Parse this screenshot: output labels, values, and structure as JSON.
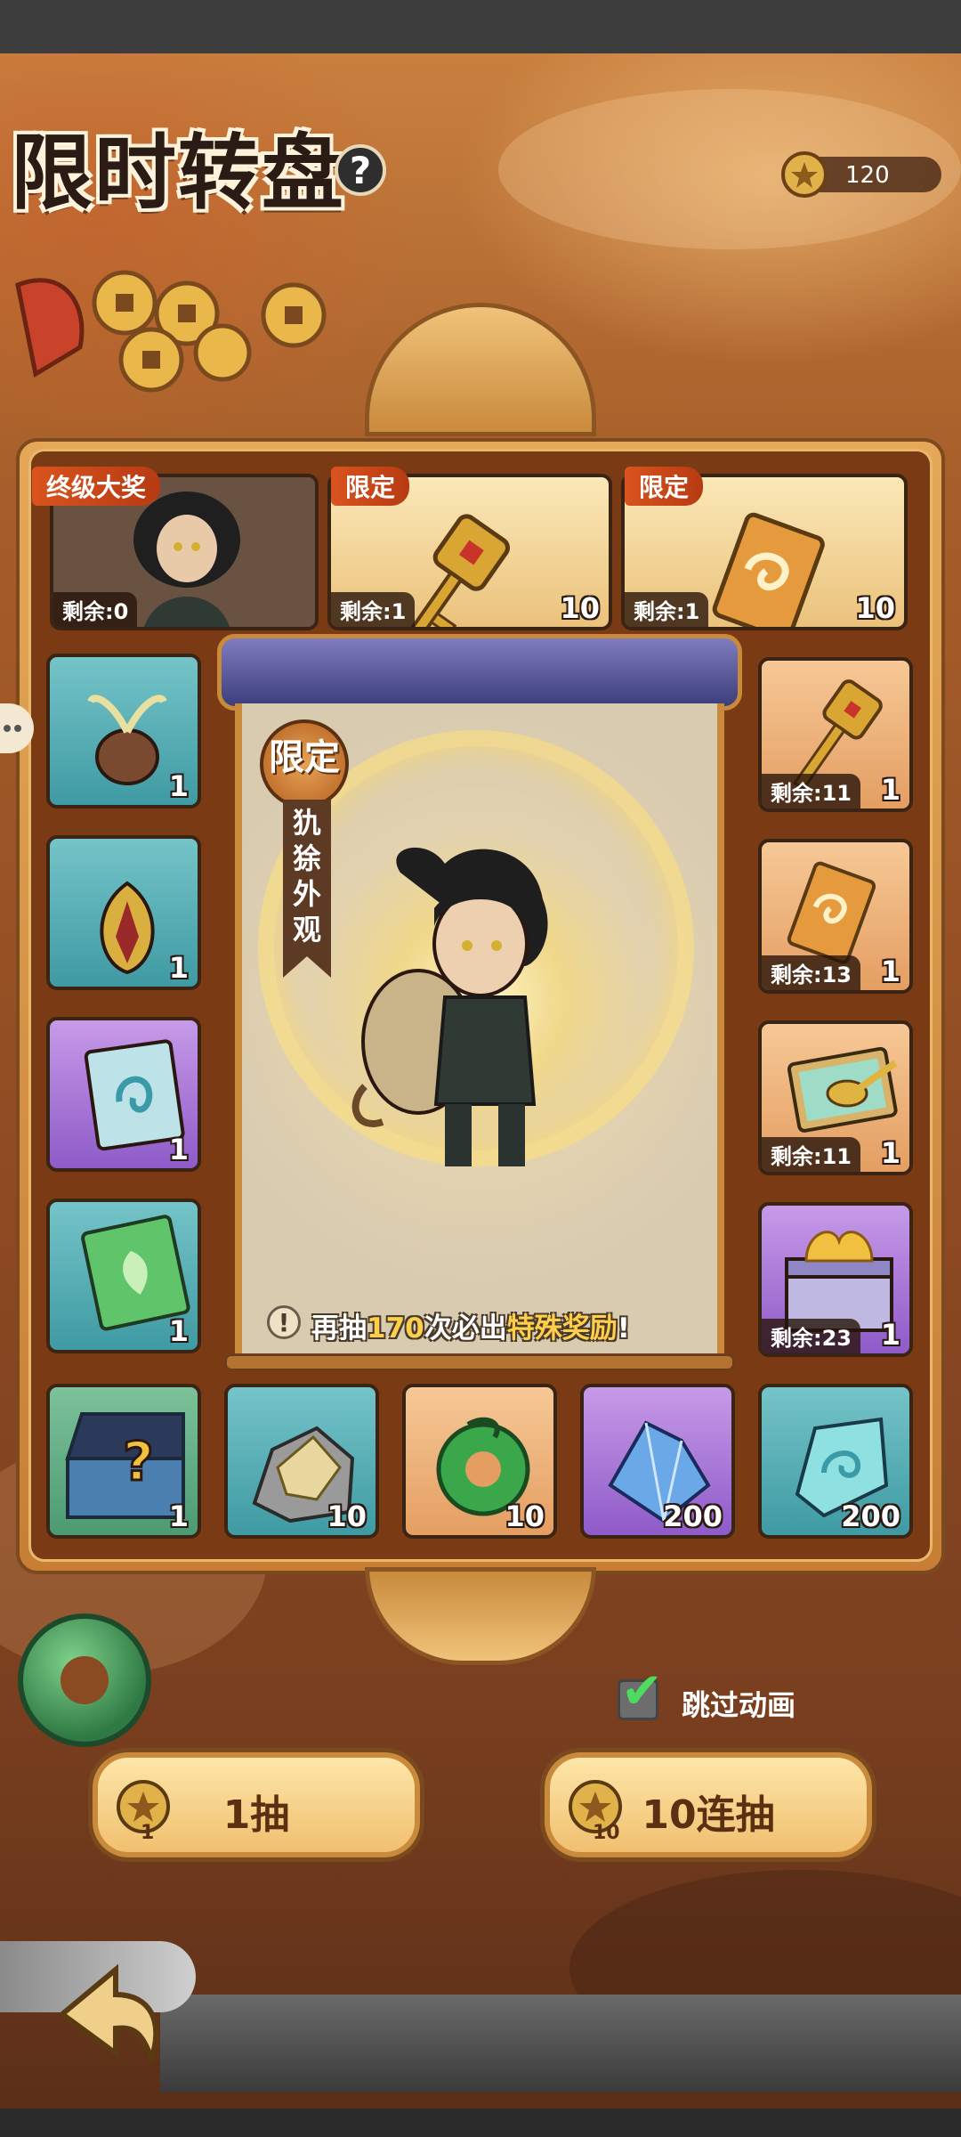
{
  "header": {
    "title": "限时转盘",
    "help_icon": "?",
    "currency_value": "120"
  },
  "top_row": [
    {
      "tag": "终级大奖",
      "remain": "剩余:0",
      "qty": "",
      "item": "character-portrait",
      "style": "dark"
    },
    {
      "tag": "限定",
      "remain": "剩余:1",
      "qty": "10",
      "item": "golden-key",
      "style": "gold"
    },
    {
      "tag": "限定",
      "remain": "剩余:1",
      "qty": "10",
      "item": "golden-ticket",
      "style": "gold"
    }
  ],
  "left_column": [
    {
      "qty": "1",
      "item": "seed-bulb",
      "style": "teal"
    },
    {
      "qty": "1",
      "item": "seed-pod",
      "style": "teal"
    },
    {
      "qty": "1",
      "item": "blue-scroll",
      "style": "purple"
    },
    {
      "qty": "1",
      "item": "leaf-ticket",
      "style": "teal"
    }
  ],
  "right_column": [
    {
      "remain": "剩余:11",
      "qty": "1",
      "item": "golden-key",
      "style": "peach"
    },
    {
      "remain": "剩余:13",
      "qty": "1",
      "item": "golden-ticket",
      "style": "peach"
    },
    {
      "remain": "剩余:11",
      "qty": "1",
      "item": "spoon-book",
      "style": "peach"
    },
    {
      "remain": "剩余:23",
      "qty": "1",
      "item": "gold-chest",
      "style": "purple"
    }
  ],
  "bottom_row": [
    {
      "qty": "1",
      "item": "mystery-chest",
      "style": "green"
    },
    {
      "qty": "10",
      "item": "ore-rock",
      "style": "teal"
    },
    {
      "qty": "10",
      "item": "jade-swirl",
      "style": "peach"
    },
    {
      "qty": "200",
      "item": "blue-crystal",
      "style": "purple"
    },
    {
      "qty": "200",
      "item": "aqua-gem",
      "style": "teal"
    }
  ],
  "center": {
    "badge": "限定",
    "ribbon_text": "犰狳外观",
    "notice": {
      "icon": "!",
      "part1": "再抽",
      "count": "170",
      "part2": "次必出",
      "reward": "特殊奖励",
      "part3": "!"
    }
  },
  "controls": {
    "skip_label": "跳过动画",
    "skip_checked": true,
    "single_draw_label": "1抽",
    "single_draw_cost": "1",
    "ten_draw_label": "10连抽",
    "ten_draw_cost": "10"
  },
  "colors": {
    "accent_gold": "#f0c070",
    "tag_red": "#d9541e",
    "highlight_yellow": "#ffce4a",
    "check_green": "#4ddc5e"
  }
}
